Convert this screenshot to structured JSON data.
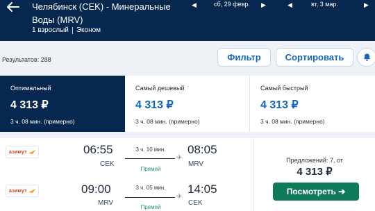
{
  "header": {
    "route": "Челябинск (CEK) - Минеральные Воды (MRV)",
    "passengers": "1 взрослый",
    "cabin": "Эконом",
    "depart_date": "сб, 29 февр.",
    "return_date": "вт, 3 мар."
  },
  "toolbar": {
    "results": "Результатов: 288",
    "filter_label": "Фильтр",
    "sort_label": "Сортировать"
  },
  "tabs": [
    {
      "label": "Оптимальный",
      "price": "4 313 ₽",
      "duration": "3 ч. 08 мин. (примерно)"
    },
    {
      "label": "Самый дешевый",
      "price": "4 313 ₽",
      "duration": "3 ч. 08 мин. (примерно)"
    },
    {
      "label": "Самый быстрый",
      "price": "4 313 ₽",
      "duration": "3 ч. 08 мин. (примерно)"
    }
  ],
  "offer": {
    "airline": "азимут",
    "legs": [
      {
        "dep_time": "06:55",
        "dep_code": "CEK",
        "duration": "3 ч. 10 мин.",
        "stops": "Прямой",
        "arr_time": "08:05",
        "arr_code": "MRV"
      },
      {
        "dep_time": "09:00",
        "dep_code": "MRV",
        "duration": "3 ч. 05 мин.",
        "stops": "Прямой",
        "arr_time": "14:05",
        "arr_code": "CEK"
      }
    ],
    "offers_count": "Предложений: 7, от",
    "price": "4 313 ₽",
    "view_label": "Посмотреть ➔"
  },
  "colors": {
    "header_bg": "#06284f",
    "accent": "#1565c0",
    "cta": "#0f7a5a",
    "direct": "#1e9a63"
  }
}
